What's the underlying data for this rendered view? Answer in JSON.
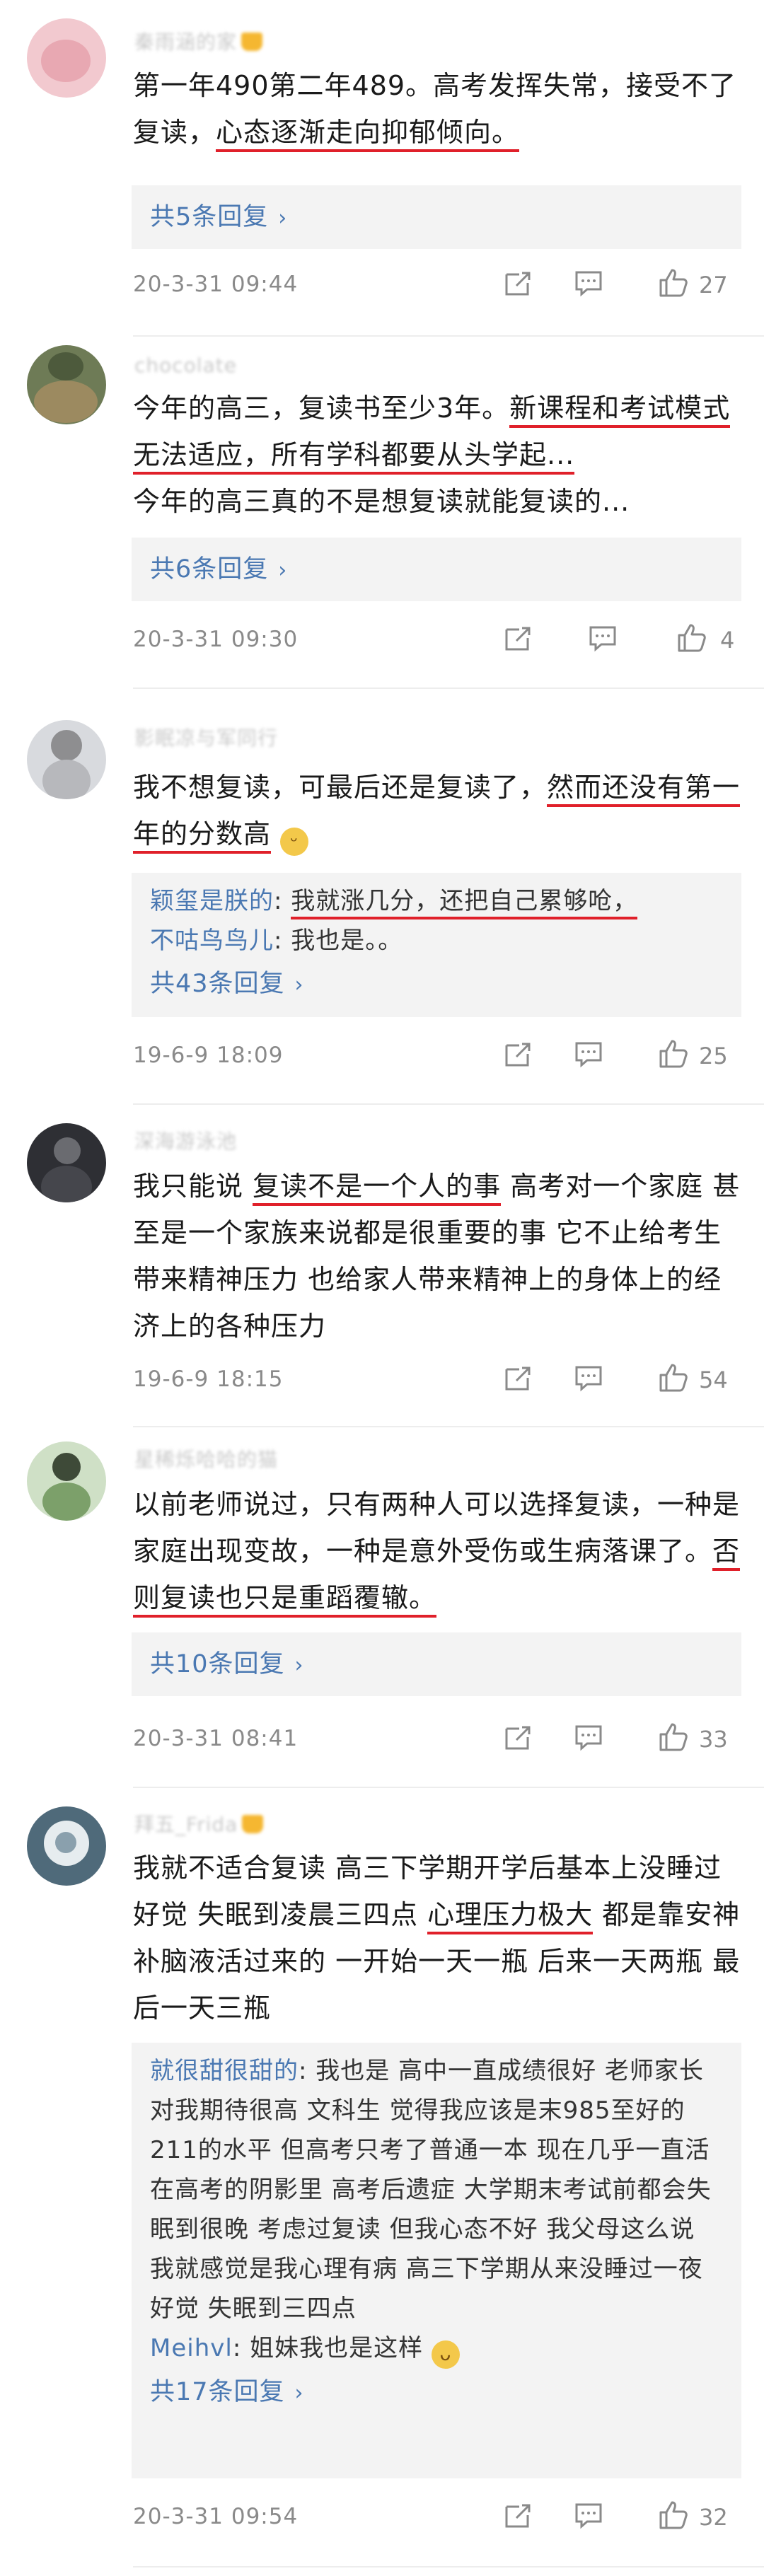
{
  "comments": [
    {
      "name": "秦雨涵的家",
      "pre": "第一年490第二年489。高考发挥失常，接受不了复读，",
      "hl": "心态逐渐走向抑郁倾向。",
      "post": "",
      "more": "共5条回复",
      "time": "20-3-31 09:44",
      "likes": "27"
    },
    {
      "name": "chocolate",
      "pre": "今年的高三，复读书至少3年。",
      "hl": "新课程和考试模式无法适应，所有学科都要从头学起...",
      "post": "今年的高三真的不是想复读就能复读的...",
      "more": "共6条回复",
      "time": "20-3-31 09:30",
      "likes": "4"
    },
    {
      "name": "影眠凉与军同行",
      "pre": "我不想复读，可最后还是复读了，",
      "hl": "然而还没有第一年的分数高",
      "post": "",
      "replies": [
        {
          "name": "颖玺是朕的",
          "text": "我就涨几分，还把自己累够呛，"
        },
        {
          "name": "不咕鸟鸟儿",
          "text": "我也是。。"
        }
      ],
      "more": "共43条回复",
      "time": "19-6-9 18:09",
      "likes": "25"
    },
    {
      "name": "深海游泳池",
      "pre": "我只能说 ",
      "hl": "复读不是一个人的事",
      "post": " 高考对一个家庭 甚至是一个家族来说都是很重要的事 它不止给考生带来精神压力 也给家人带来精神上的身体上的经济上的各种压力",
      "time": "19-6-9 18:15",
      "likes": "54"
    },
    {
      "name": "星稀烁哈哈的猫",
      "pre": "以前老师说过，只有两种人可以选择复读，一种是家庭出现变故，一种是意外受伤或生病落课了。",
      "hl": "否则复读也只是重蹈覆辙。",
      "post": "",
      "more": "共10条回复",
      "time": "20-3-31 08:41",
      "likes": "33"
    },
    {
      "name": "拜五_Frida",
      "pre": "我就不适合复读 高三下学期开学后基本上没睡过好觉 失眠到凌晨三四点 ",
      "hl": "心理压力极大",
      "post": " 都是靠安神补脑液活过来的 一开始一天一瓶 后来一天两瓶 最后一天三瓶",
      "replies": [
        {
          "name": "就很甜很甜的",
          "text": "我也是 高中一直成绩很好 老师家长对我期待很高 文科生 觉得我应该是末985至好的211的水平 但高考只考了普通一本 现在几乎一直活在高考的阴影里 高考后遗症 大学期末考试前都会失眠到很晚 考虑过复读 但我心态不好 我父母这么说 我就感觉是我心理有病 高三下学期从来没睡过一夜好觉 失眠到三四点"
        },
        {
          "name": "Meihvl",
          "text": "姐妹我也是这样"
        }
      ],
      "more": "共17条回复",
      "time": "20-3-31 09:54",
      "likes": "32"
    }
  ],
  "colors": {
    "accent": "#e0202a",
    "link": "#4a78b2",
    "meta": "#8a8a8a"
  },
  "icons": [
    "share-icon",
    "comment-icon",
    "like-icon",
    "vip-crown-icon"
  ]
}
